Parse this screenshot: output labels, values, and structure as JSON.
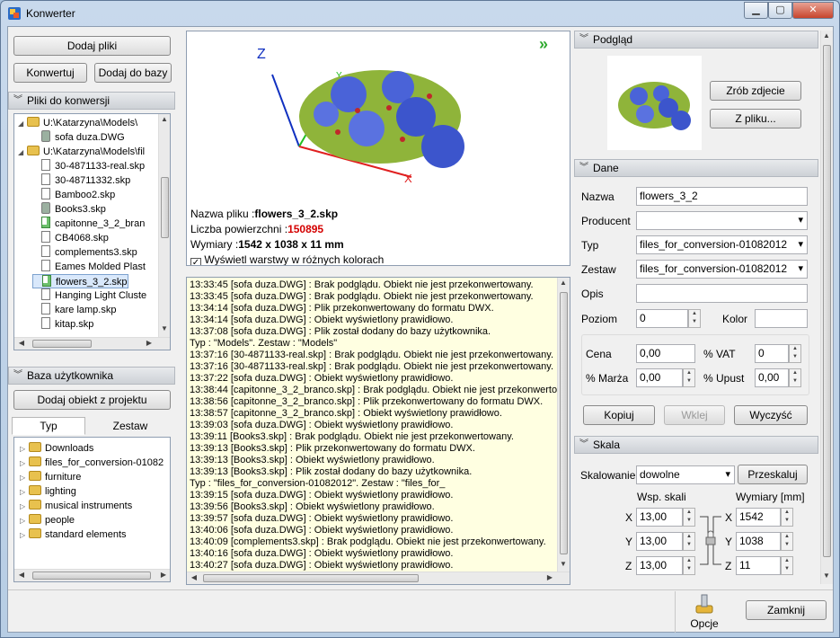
{
  "window": {
    "title": "Konwerter",
    "controls": [
      "▁",
      "▢",
      "✕"
    ]
  },
  "left": {
    "add_files": "Dodaj pliki",
    "convert": "Konwertuj",
    "add_to_db": "Dodaj do bazy",
    "files_header": "Pliki do konwersji",
    "files_tree": [
      {
        "label": "U:\\Katarzyna\\Models\\",
        "kind": "folder",
        "level": 0
      },
      {
        "label": "sofa duza.DWG",
        "kind": "db",
        "level": 1
      },
      {
        "label": "U:\\Katarzyna\\Models\\fil",
        "kind": "folder",
        "level": 0
      },
      {
        "label": "30-4871133-real.skp",
        "kind": "file",
        "level": 1
      },
      {
        "label": "30-48711332.skp",
        "kind": "file",
        "level": 1
      },
      {
        "label": "Bamboo2.skp",
        "kind": "file",
        "level": 1
      },
      {
        "label": "Books3.skp",
        "kind": "db",
        "level": 1
      },
      {
        "label": "capitonne_3_2_bran",
        "kind": "green",
        "level": 1
      },
      {
        "label": "CB4068.skp",
        "kind": "file",
        "level": 1
      },
      {
        "label": "complements3.skp",
        "kind": "file",
        "level": 1
      },
      {
        "label": "Eames Molded Plast",
        "kind": "file",
        "level": 1
      },
      {
        "label": "flowers_3_2.skp",
        "kind": "green",
        "level": 1,
        "selected": true
      },
      {
        "label": "Hanging Light Cluste",
        "kind": "file",
        "level": 1
      },
      {
        "label": "kare lamp.skp",
        "kind": "file",
        "level": 1
      },
      {
        "label": "kitap.skp",
        "kind": "file",
        "level": 1
      }
    ],
    "user_db_header": "Baza użytkownika",
    "add_object": "Dodaj obiekt z projektu",
    "tab_type": "Typ",
    "tab_set": "Zestaw",
    "db_tree": [
      "Downloads",
      "files_for_conversion-01082",
      "furniture",
      "lighting",
      "musical instruments",
      "people",
      "standard elements"
    ]
  },
  "viewer": {
    "axis_x": "X",
    "axis_y": "Y",
    "axis_z": "Z",
    "expand_icon": "double-chevron-right-icon",
    "file_name_label": "Nazwa pliku :",
    "file_name": "flowers_3_2.skp",
    "surfaces_label": "Liczba powierzchni :",
    "surfaces": "150895",
    "dims_label": "Wymiary :",
    "dims": "1542 x 1038 x 11 mm",
    "layers_checkbox": "Wyświetl warstwy w różnych kolorach"
  },
  "log": [
    "13:33:45 [sofa duza.DWG] : Brak podglądu. Obiekt nie jest przekonwertowany.",
    "13:33:45 [sofa duza.DWG] : Brak podglądu. Obiekt nie jest przekonwertowany.",
    "13:34:14 [sofa duza.DWG] : Plik przekonwertowany do formatu DWX.",
    "13:34:14 [sofa duza.DWG] : Obiekt wyświetlony prawidłowo.",
    "13:37:08 [sofa duza.DWG] : Plik został dodany do bazy użytkownika.",
    "                    Typ : \"Models\". Zestaw : \"Models\"",
    "13:37:16 [30-4871133-real.skp] : Brak podglądu. Obiekt nie jest przekonwertowany.",
    "13:37:16 [30-4871133-real.skp] : Brak podglądu. Obiekt nie jest przekonwertowany.",
    "13:37:22 [sofa duza.DWG] : Obiekt wyświetlony prawidłowo.",
    "13:38:44 [capitonne_3_2_branco.skp] : Brak podglądu. Obiekt nie jest przekonwerto",
    "13:38:56 [capitonne_3_2_branco.skp] : Plik przekonwertowany do formatu DWX.",
    "13:38:57 [capitonne_3_2_branco.skp] : Obiekt wyświetlony prawidłowo.",
    "13:39:03 [sofa duza.DWG] : Obiekt wyświetlony prawidłowo.",
    "13:39:11 [Books3.skp] : Brak podglądu. Obiekt nie jest przekonwertowany.",
    "13:39:13 [Books3.skp] : Plik przekonwertowany do formatu DWX.",
    "13:39:13 [Books3.skp] : Obiekt wyświetlony prawidłowo.",
    "13:39:13 [Books3.skp] : Plik został dodany do bazy użytkownika.",
    "                    Typ : \"files_for_conversion-01082012\". Zestaw : \"files_for_",
    "13:39:15 [sofa duza.DWG] : Obiekt wyświetlony prawidłowo.",
    "13:39:56 [Books3.skp] : Obiekt wyświetlony prawidłowo.",
    "13:39:57 [sofa duza.DWG] : Obiekt wyświetlony prawidłowo.",
    "13:40:06 [sofa duza.DWG] : Obiekt wyświetlony prawidłowo.",
    "13:40:09 [complements3.skp] : Brak podglądu. Obiekt nie jest przekonwertowany.",
    "13:40:16 [sofa duza.DWG] : Obiekt wyświetlony prawidłowo.",
    "13:40:27 [sofa duza.DWG] : Obiekt wyświetlony prawidłowo."
  ],
  "preview": {
    "header": "Podgląd",
    "take_photo": "Zrób zdjecie",
    "from_file": "Z pliku..."
  },
  "data": {
    "header": "Dane",
    "name_label": "Nazwa",
    "name_value": "flowers_3_2",
    "producer_label": "Producent",
    "producer_value": "",
    "type_label": "Typ",
    "type_value": "files_for_conversion-01082012",
    "set_label": "Zestaw",
    "set_value": "files_for_conversion-01082012",
    "desc_label": "Opis",
    "desc_value": "",
    "level_label": "Poziom",
    "level_value": "0",
    "color_label": "Kolor",
    "color_value": "",
    "price_label": "Cena",
    "price_value": "0,00",
    "vat_label": "% VAT",
    "vat_value": "0",
    "margin_label": "% Marża",
    "margin_value": "0,00",
    "discount_label": "% Upust",
    "discount_value": "0,00",
    "copy": "Kopiuj",
    "paste": "Wklej",
    "clear": "Wyczyść"
  },
  "scale": {
    "header": "Skala",
    "scaling_label": "Skalowanie",
    "scaling_value": "dowolne",
    "rescale": "Przeskaluj",
    "factor_header": "Wsp. skali",
    "dims_header": "Wymiary [mm]",
    "x_label": "X",
    "y_label": "Y",
    "z_label": "Z",
    "fx": "13,00",
    "fy": "13,00",
    "fz": "13,00",
    "dx": "1542",
    "dy": "1038",
    "dz": "11"
  },
  "footer": {
    "options": "Opcje",
    "close": "Zamknij"
  },
  "colors": {
    "surfaces_red": "#d40000",
    "axis_x": "#e02020",
    "axis_y": "#20c020",
    "axis_z": "#1030c0"
  }
}
